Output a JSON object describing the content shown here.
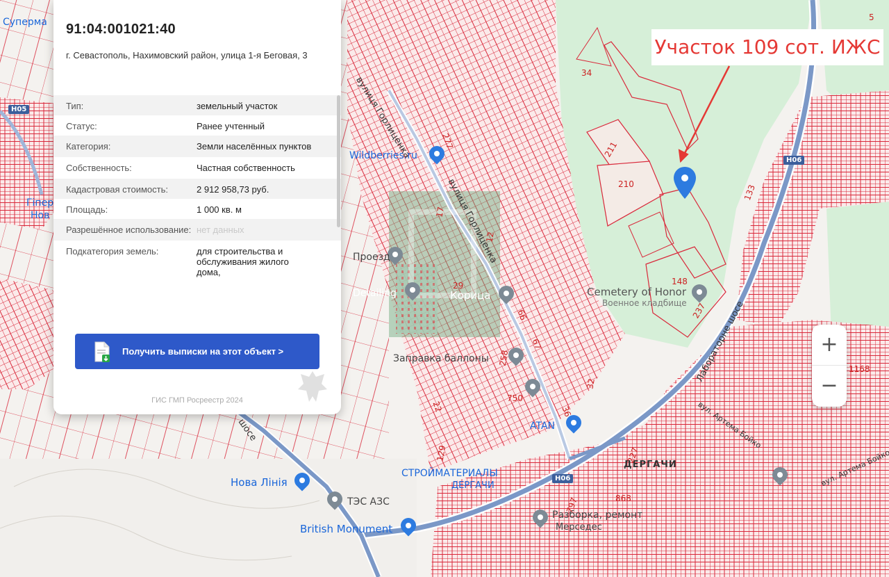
{
  "object": {
    "cadastral_number": "91:04:001021:40",
    "address": "г. Севастополь, Нахимовский район, улица 1-я Беговая, 3"
  },
  "properties": [
    {
      "key": "Тип:",
      "value": "земельный участок"
    },
    {
      "key": "Статус:",
      "value": "Ранее учтенный"
    },
    {
      "key": "Категория:",
      "value": "Земли населённых пунктов"
    },
    {
      "key": "Собственность:",
      "value": "Частная собственность"
    },
    {
      "key": "Кадастровая стоимость:",
      "value": "2 912 958,73 руб."
    },
    {
      "key": "Площадь:",
      "value": "1 000 кв. м"
    },
    {
      "key": "Разрешённое использование:",
      "value": "нет данных"
    },
    {
      "key": "Подкатегория земель:",
      "value": "для строительства и обслуживания жилого дома,"
    }
  ],
  "actions": {
    "get_extract_label": "Получить выписки на этот объект >"
  },
  "footer": "ГИС ГМП Росреестр 2024",
  "annotation": "Участок 109 сот. ИЖС",
  "zoom": {
    "in": "+",
    "out": "−"
  },
  "map": {
    "streets": {
      "gorlitsenka_top": "вулиця Горлиценка",
      "gorlitsenka_mid": "вулиця Горлиценка",
      "laboratornoe": "Лабораторне шосе",
      "artema_boyko_1": "вул. Артема Бойко",
      "artema_boyko_2": "вул. Артема Бойко",
      "shose_left": "шосе"
    },
    "roads": {
      "h05": "H05",
      "h06_a": "H06",
      "h06_b": "H06"
    },
    "districts": {
      "dergachi": "ДЕРГАЧИ"
    },
    "pois": {
      "wildberries": "Wildberries.ru",
      "cemetery": "Cemetery of Honor",
      "cemetery_ru": "Военное кладбище",
      "koritsa": "Корица",
      "zapravka": "Заправка баллоны",
      "atan": "ATAN",
      "stroymaterialy": "СТРОЙМАТЕРИАЛЫ",
      "dergachi_store": "ДЕРГАЧИ",
      "razborka": "Разборка, ремонт",
      "mersedes": "Мерседес",
      "nova_liniya": "Нова Лінія",
      "tes_azs": "ТЭС АЗС",
      "british_monument": "British Monument",
      "supermarket": "Суперма",
      "nova": "Нов",
      "detailing": "Detailing",
      "proezd": "Проезд",
      "giper": "Гіпер"
    },
    "parcel_numbers": {
      "n34": "34",
      "n211": "211",
      "n210": "210",
      "n148": "148",
      "n237": "237",
      "n133": "133",
      "n277": "277",
      "n17": "17",
      "n12": "12",
      "n29": "29",
      "n66": "66",
      "n67": "67",
      "n258": "258",
      "n32": "32",
      "n36": "36",
      "n750": "750",
      "n22": "22",
      "n129": "129",
      "n868": "868",
      "n1168": "1168",
      "n5": "5",
      "n797": "797",
      "n227": "227"
    },
    "colors": {
      "parcel": "#d9283a",
      "road": "#7b98c7",
      "water_road": "#6d8fc3",
      "park": "#d6efd8"
    }
  }
}
